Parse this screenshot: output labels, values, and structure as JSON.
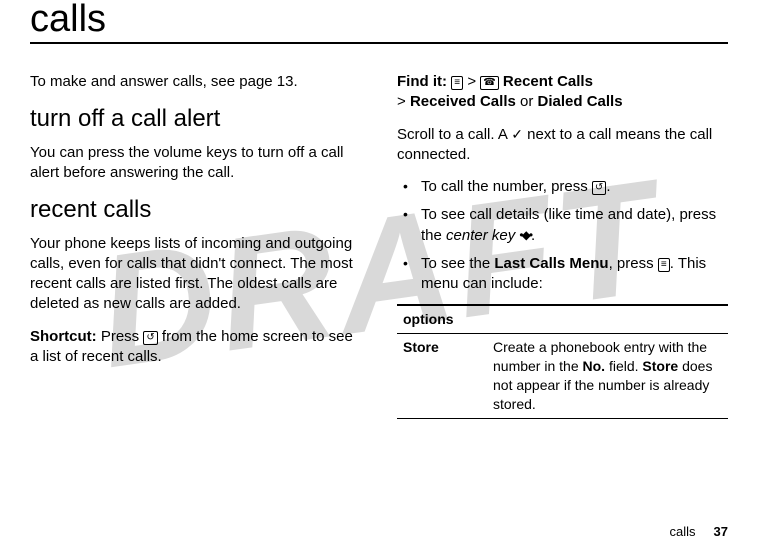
{
  "watermark": "DRAFT",
  "chapter_title": "calls",
  "left": {
    "intro": "To make and answer calls, see page 13.",
    "section1_title": "turn off a call alert",
    "section1_body": "You can press the volume keys to turn off a call alert before answering the call.",
    "section2_title": "recent calls",
    "section2_body": "Your phone keeps lists of incoming and outgoing calls, even for calls that didn't connect. The most recent calls are listed first. The oldest calls are deleted as new calls are added.",
    "shortcut_label": "Shortcut:",
    "shortcut_pre": " Press ",
    "shortcut_icon": "↺",
    "shortcut_post": " from the home screen to see a list of recent calls."
  },
  "right": {
    "findit_label": "Find it:",
    "findit_icon1": "≡",
    "findit_gt": " > ",
    "findit_icon2": "☎",
    "findit_recent": " Recent Calls",
    "findit_line2_pre": "> ",
    "findit_received": "Received Calls",
    "findit_or": " or ",
    "findit_dialed": "Dialed Calls",
    "scroll_pre": "Scroll to a call. A ",
    "scroll_check": "✓",
    "scroll_post": " next to a call means the call connected.",
    "bullets": {
      "b1_pre": "To call the number, press ",
      "b1_icon": "↺",
      "b1_post": ".",
      "b2_pre": "To see call details (like time and date), press the ",
      "b2_ital": "center key",
      "b2_icon": "•◆•",
      "b2_post": ".",
      "b3_pre": "To see the ",
      "b3_menu": "Last Calls Menu",
      "b3_mid": ", press ",
      "b3_icon": "≡",
      "b3_post": ". This menu can include:"
    },
    "table": {
      "header": "options",
      "row1_label": "Store",
      "row1_pre": "Create a phonebook entry with the number in the ",
      "row1_no": "No.",
      "row1_mid": " field. ",
      "row1_store": "Store",
      "row1_post": " does not appear if the number is already stored."
    }
  },
  "footer": {
    "label": "calls",
    "page": "37"
  }
}
